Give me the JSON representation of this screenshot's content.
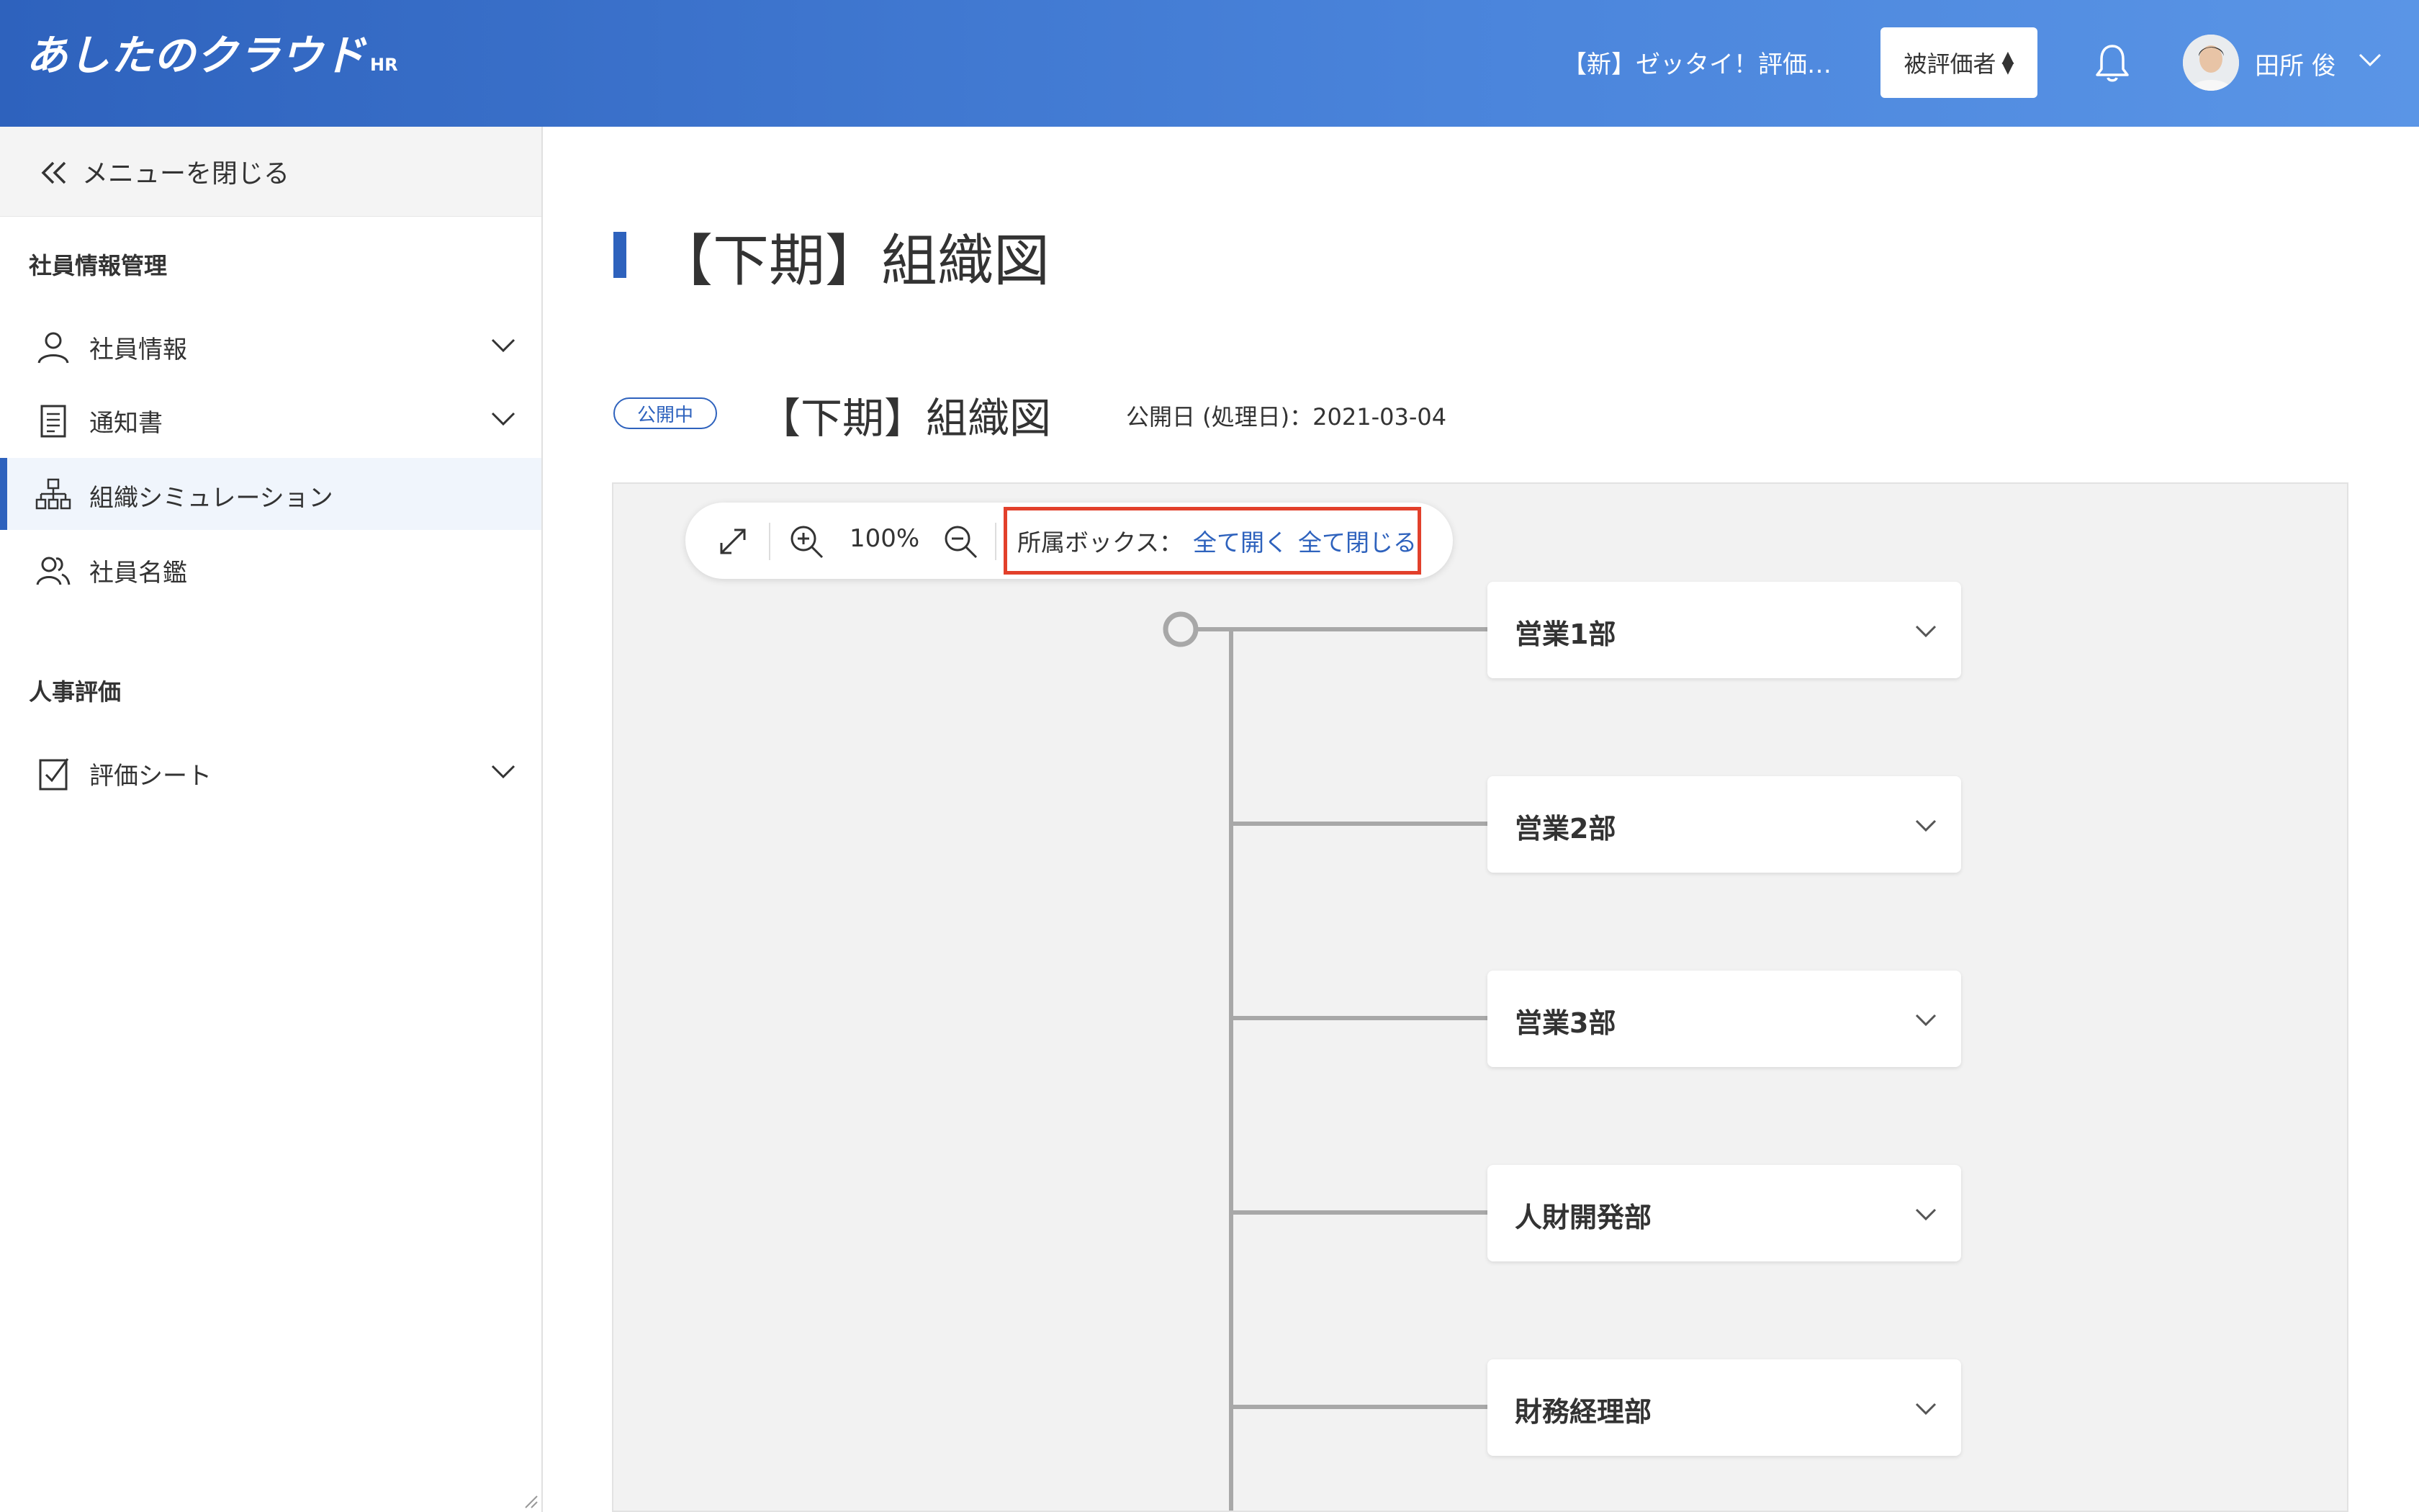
{
  "app": {
    "logo_main": "あしたのクラウド",
    "logo_sub": "HR"
  },
  "header": {
    "evaluation_title": "【新】ゼッタイ！評価…",
    "role_selector": "被評価者",
    "user_name": "田所 俊"
  },
  "sidebar": {
    "close_menu": "メニューを閉じる",
    "sections": [
      {
        "title": "社員情報管理",
        "items": [
          {
            "label": "社員情報",
            "icon": "person-icon",
            "expandable": true
          },
          {
            "label": "通知書",
            "icon": "document-icon",
            "expandable": true
          },
          {
            "label": "組織シミュレーション",
            "icon": "org-chart-icon",
            "active": true
          },
          {
            "label": "社員名鑑",
            "icon": "people-icon"
          }
        ]
      },
      {
        "title": "人事評価",
        "items": [
          {
            "label": "評価シート",
            "icon": "checkbox-icon",
            "expandable": true
          }
        ]
      }
    ]
  },
  "main": {
    "page_title": "【下期】組織図",
    "status_badge": "公開中",
    "chart_title": "【下期】組織図",
    "publish_date": "公開日 (処理日)：2021-03-04",
    "toolbar": {
      "zoom_level": "100%",
      "box_label": "所属ボックス：",
      "expand_all": "全て開く",
      "collapse_all": "全て閉じる"
    },
    "departments": [
      "営業1部",
      "営業2部",
      "営業3部",
      "人財開発部",
      "財務経理部"
    ]
  },
  "colors": {
    "header_start": "#2e62bd",
    "header_end": "#5a95e6",
    "accent": "#2e62bd",
    "highlight_border": "#e2402b"
  }
}
